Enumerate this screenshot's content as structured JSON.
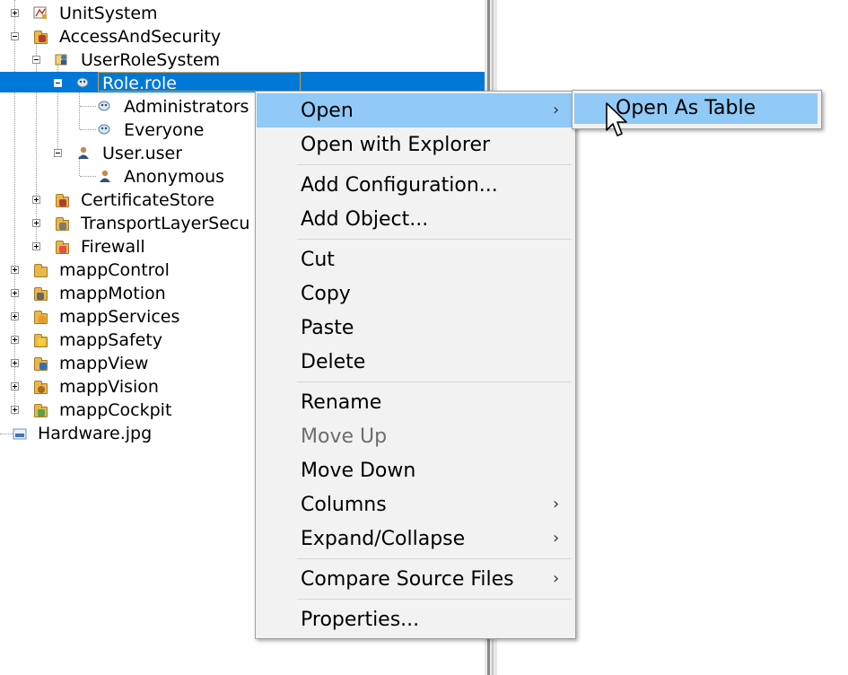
{
  "tree": {
    "items": [
      {
        "label": "UnitSystem"
      },
      {
        "label": "AccessAndSecurity"
      },
      {
        "label": "UserRoleSystem"
      },
      {
        "label": "Role.role"
      },
      {
        "label": "Administrators"
      },
      {
        "label": "Everyone"
      },
      {
        "label": "User.user"
      },
      {
        "label": "Anonymous"
      },
      {
        "label": "CertificateStore"
      },
      {
        "label": "TransportLayerSecu"
      },
      {
        "label": "Firewall"
      },
      {
        "label": "mappControl"
      },
      {
        "label": "mappMotion"
      },
      {
        "label": "mappServices"
      },
      {
        "label": "mappSafety"
      },
      {
        "label": "mappView"
      },
      {
        "label": "mappVision"
      },
      {
        "label": "mappCockpit"
      },
      {
        "label": "Hardware.jpg"
      }
    ],
    "selected_index": 3
  },
  "context_menu": {
    "items": {
      "open": "Open",
      "open_with_explorer": "Open with Explorer",
      "add_configuration": "Add Configuration...",
      "add_object": "Add Object...",
      "cut": "Cut",
      "copy": "Copy",
      "paste": "Paste",
      "delete": "Delete",
      "rename": "Rename",
      "move_up": "Move Up",
      "move_down": "Move Down",
      "columns": "Columns",
      "expand_collapse": "Expand/Collapse",
      "compare_source_files": "Compare Source Files",
      "properties": "Properties..."
    },
    "submenu_arrow": "›",
    "highlighted": "open"
  },
  "submenu": {
    "open_as_table": "Open As Table"
  },
  "colors": {
    "selection": "#0078d7",
    "menu_highlight": "#91c9f7",
    "menu_background": "#f2f2f2",
    "disabled_text": "#6d6d6d"
  },
  "icons": {
    "cursor": "arrow-cursor-icon",
    "expander": "tree-expander-icon",
    "folder": "folder-icon",
    "role": "role-icon",
    "user": "user-icon",
    "image": "image-file-icon"
  }
}
